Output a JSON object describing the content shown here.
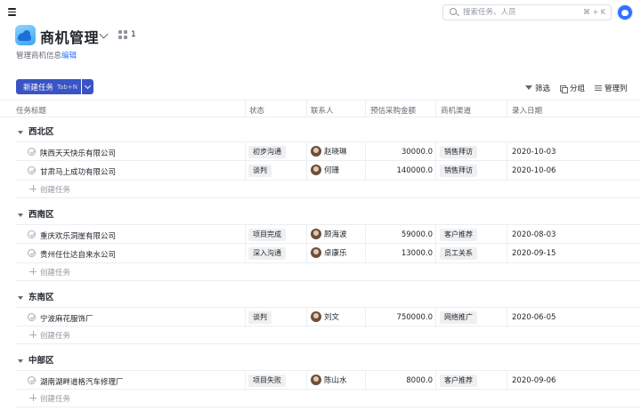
{
  "search": {
    "placeholder": "搜索任务、人员",
    "shortcut": "⌘ + K"
  },
  "project": {
    "title": "商机管理",
    "member_count": "1",
    "subtitle": "管理商机信息",
    "edit_label": "编辑"
  },
  "toolbar": {
    "new_task_label": "新建任务",
    "new_task_shortcut": "Tab+N",
    "filter_label": "筛选",
    "group_label": "分组",
    "columns_label": "管理列"
  },
  "columns": [
    "任务标题",
    "状态",
    "联系人",
    "预估采购金额",
    "商机渠道",
    "录入日期"
  ],
  "add_task_label": "创建任务",
  "groups": [
    {
      "name": "西北区",
      "rows": [
        {
          "title": "陕西天天快乐有限公司",
          "status": "初步沟通",
          "contact": "赵晓琳",
          "amount": "30000.0",
          "channel": "销售拜访",
          "date": "2020-10-03"
        },
        {
          "title": "甘肃马上成功有限公司",
          "status": "谈判",
          "contact": "何珊",
          "amount": "140000.0",
          "channel": "销售拜访",
          "date": "2020-10-06"
        }
      ]
    },
    {
      "name": "西南区",
      "rows": [
        {
          "title": "重庆欢乐洞崖有限公司",
          "status": "项目完成",
          "contact": "顾海波",
          "amount": "59000.0",
          "channel": "客户推荐",
          "date": "2020-08-03"
        },
        {
          "title": "贵州任仕达自来水公司",
          "status": "深入沟通",
          "contact": "卓康乐",
          "amount": "13000.0",
          "channel": "员工关系",
          "date": "2020-09-15"
        }
      ]
    },
    {
      "name": "东南区",
      "rows": [
        {
          "title": "宁波麻花服饰厂",
          "status": "谈判",
          "contact": "刘文",
          "amount": "750000.0",
          "channel": "网络推广",
          "date": "2020-06-05"
        }
      ]
    },
    {
      "name": "中部区",
      "rows": [
        {
          "title": "湖南湖畔道格汽车修理厂",
          "status": "项目失败",
          "contact": "陈山水",
          "amount": "8000.0",
          "channel": "客户推荐",
          "date": "2020-09-06"
        }
      ]
    }
  ]
}
